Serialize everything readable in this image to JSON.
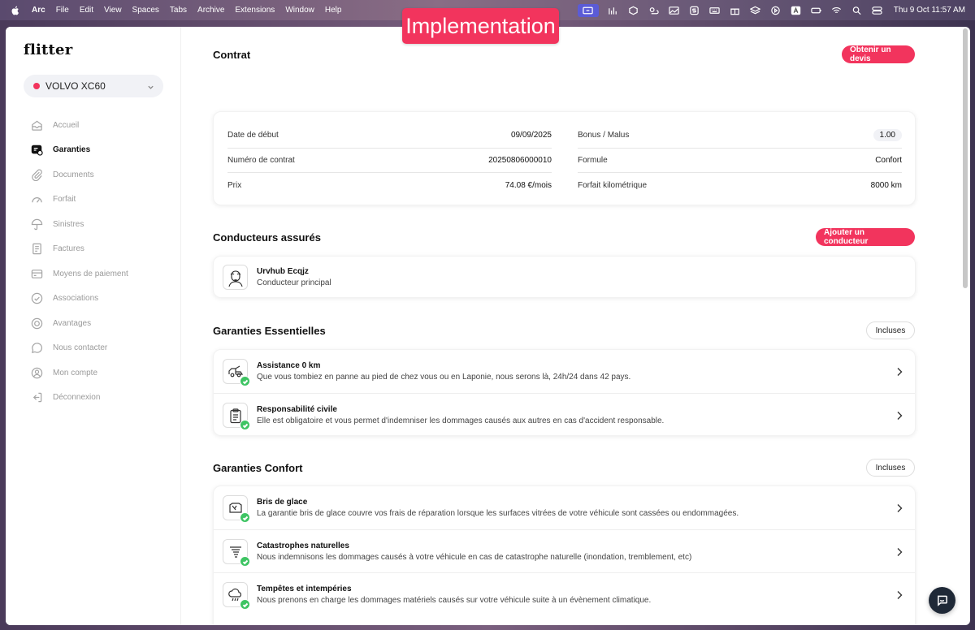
{
  "menubar": {
    "items": [
      "Arc",
      "File",
      "Edit",
      "View",
      "Spaces",
      "Tabs",
      "Archive",
      "Extensions",
      "Window",
      "Help"
    ],
    "clock": "Thu 9 Oct  11:57 AM"
  },
  "badge": "Implementation",
  "sidebar": {
    "logo": "flitter",
    "vehicle": "VOLVO XC60",
    "items": [
      {
        "label": "Accueil"
      },
      {
        "label": "Garanties"
      },
      {
        "label": "Documents"
      },
      {
        "label": "Forfait"
      },
      {
        "label": "Sinistres"
      },
      {
        "label": "Factures"
      },
      {
        "label": "Moyens de paiement"
      },
      {
        "label": "Associations"
      },
      {
        "label": "Avantages"
      },
      {
        "label": "Nous contacter"
      },
      {
        "label": "Mon compte"
      },
      {
        "label": "Déconnexion"
      }
    ]
  },
  "contract": {
    "title": "Contrat",
    "quote_button": "Obtenir un devis",
    "left": [
      {
        "label": "Date de début",
        "value": "09/09/2025"
      },
      {
        "label": "Numéro de contrat",
        "value": "20250806000010"
      },
      {
        "label": "Prix",
        "value": "74.08 €/mois"
      }
    ],
    "right": [
      {
        "label": "Bonus / Malus",
        "value": "1.00"
      },
      {
        "label": "Formule",
        "value": "Confort"
      },
      {
        "label": "Forfait kilométrique",
        "value": "8000 km"
      }
    ]
  },
  "drivers": {
    "title": "Conducteurs assurés",
    "add_button": "Ajouter un conducteur",
    "name": "Urvhub Ecqjz",
    "role": "Conducteur principal"
  },
  "essentials": {
    "title": "Garanties Essentielles",
    "badge": "Incluses",
    "items": [
      {
        "title": "Assistance 0 km",
        "desc": "Que vous tombiez en panne au pied de chez vous ou en Laponie, nous serons là, 24h/24 dans 42 pays."
      },
      {
        "title": "Responsabilité civile",
        "desc": "Elle est obligatoire et vous permet d'indemniser les dommages causés aux autres en cas d'accident responsable."
      }
    ]
  },
  "comfort": {
    "title": "Garanties Confort",
    "badge": "Incluses",
    "items": [
      {
        "title": "Bris de glace",
        "desc": "La garantie bris de glace couvre vos frais de réparation lorsque les surfaces vitrées de votre véhicule sont cassées ou endommagées."
      },
      {
        "title": "Catastrophes naturelles",
        "desc": "Nous indemnisons les dommages causés à votre véhicule en cas de catastrophe naturelle (inondation, tremblement, etc)"
      },
      {
        "title": "Tempêtes et intempéries",
        "desc": "Nous prenons en charge les dommages matériels causés sur votre véhicule suite à un évènement climatique."
      }
    ]
  }
}
